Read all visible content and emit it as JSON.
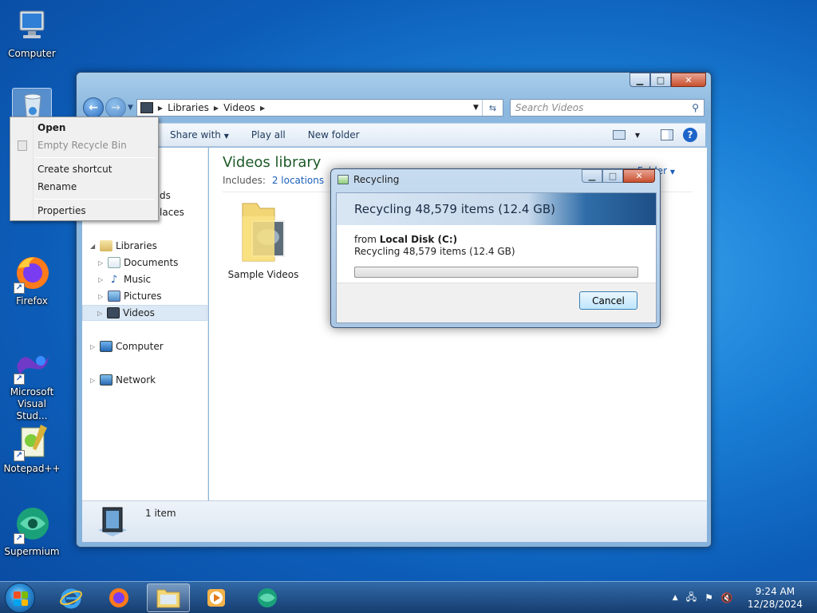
{
  "desktop": {
    "icons": [
      {
        "label": "Computer"
      },
      {
        "label": "Recycle Bin"
      },
      {
        "label": "Firefox"
      },
      {
        "label": "Microsoft Visual Stud..."
      },
      {
        "label": "Notepad++"
      },
      {
        "label": "Supermium"
      }
    ]
  },
  "explorer": {
    "address": {
      "crumbs": [
        "Libraries",
        "Videos"
      ]
    },
    "search": {
      "placeholder": "Search Videos"
    },
    "toolbar": {
      "share": "Share with",
      "play_all": "Play all",
      "new_folder": "New folder"
    },
    "nav": {
      "favorites_partial": [
        "ds",
        "laces"
      ],
      "libraries": "Libraries",
      "documents": "Documents",
      "music": "Music",
      "pictures": "Pictures",
      "videos": "Videos",
      "computer": "Computer",
      "network": "Network"
    },
    "library": {
      "title": "Videos library",
      "includes_label": "Includes:",
      "locations": "2 locations",
      "arrange_partial": "Folder"
    },
    "items": [
      {
        "name": "Sample Videos"
      }
    ],
    "status": {
      "count": "1 item"
    }
  },
  "context_menu": {
    "items": [
      {
        "label": "Open"
      },
      {
        "label": "Empty Recycle Bin"
      },
      {
        "label": "Create shortcut"
      },
      {
        "label": "Rename"
      },
      {
        "label": "Properties"
      }
    ]
  },
  "dialog": {
    "title": "Recycling",
    "heading": "Recycling 48,579 items (12.4 GB)",
    "from_label": "from",
    "from_location": "Local Disk (C:)",
    "detail": "Recycling 48,579 items (12.4 GB)",
    "progress": 0,
    "cancel": "Cancel"
  },
  "taskbar": {
    "time": "9:24 AM",
    "date": "12/28/2024"
  }
}
